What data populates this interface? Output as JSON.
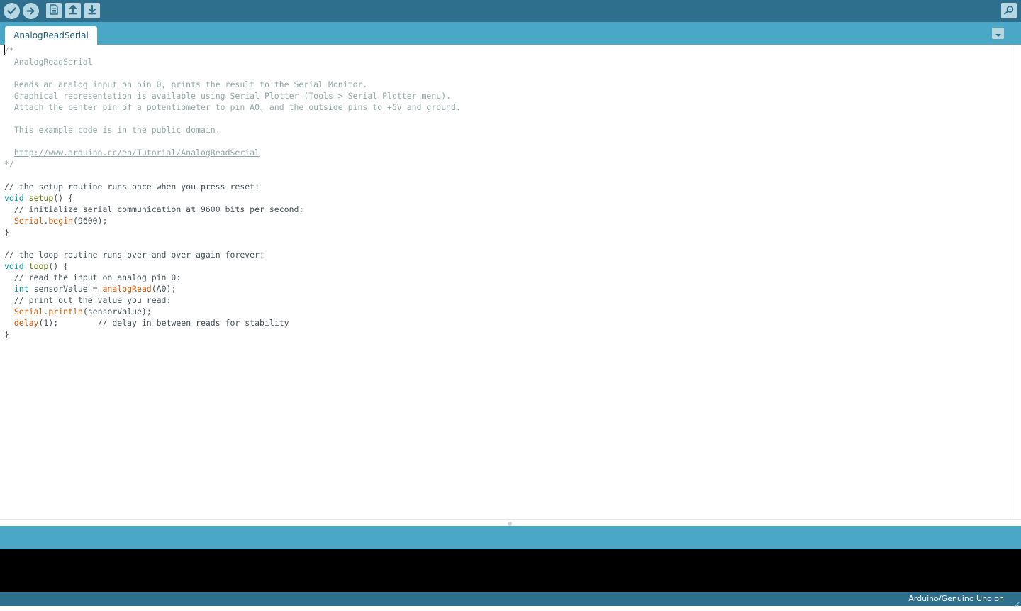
{
  "toolbar": {
    "buttons": [
      {
        "name": "verify",
        "icon": "checkmark-icon"
      },
      {
        "name": "upload",
        "icon": "arrow-right-icon"
      },
      {
        "name": "new",
        "icon": "new-file-icon"
      },
      {
        "name": "open",
        "icon": "open-up-arrow-icon"
      },
      {
        "name": "save",
        "icon": "save-down-arrow-icon"
      }
    ],
    "serial_monitor_icon": "magnifier-icon"
  },
  "tabs": [
    {
      "label": "AnalogReadSerial",
      "active": true
    }
  ],
  "tab_menu_icon": "chevron-down-icon",
  "editor": {
    "lines": [
      [
        {
          "t": "/*",
          "c": "c"
        }
      ],
      [
        {
          "t": "  AnalogReadSerial",
          "c": "c"
        }
      ],
      [],
      [
        {
          "t": "  Reads an analog input on pin 0, prints the result to the Serial Monitor.",
          "c": "c"
        }
      ],
      [
        {
          "t": "  Graphical representation is available using Serial Plotter (Tools > Serial Plotter menu).",
          "c": "c"
        }
      ],
      [
        {
          "t": "  Attach the center pin of a potentiometer to pin A0, and the outside pins to +5V and ground.",
          "c": "c"
        }
      ],
      [],
      [
        {
          "t": "  This example code is in the public domain.",
          "c": "c"
        }
      ],
      [],
      [
        {
          "t": "  ",
          "c": "c"
        },
        {
          "t": "http://www.arduino.cc/en/Tutorial/AnalogReadSerial",
          "c": "u"
        }
      ],
      [
        {
          "t": "*/",
          "c": "c"
        }
      ],
      [],
      [
        {
          "t": "// the setup routine runs once when you press reset:",
          "c": "p"
        }
      ],
      [
        {
          "t": "void",
          "c": "kw"
        },
        {
          "t": " ",
          "c": "p"
        },
        {
          "t": "setup",
          "c": "fn"
        },
        {
          "t": "() {",
          "c": "p"
        }
      ],
      [
        {
          "t": "  // initialize serial communication at 9600 bits per second:",
          "c": "p"
        }
      ],
      [
        {
          "t": "  ",
          "c": "p"
        },
        {
          "t": "Serial",
          "c": "lib"
        },
        {
          "t": ".",
          "c": "p"
        },
        {
          "t": "begin",
          "c": "lib"
        },
        {
          "t": "(9600);",
          "c": "p"
        }
      ],
      [
        {
          "t": "}",
          "c": "p"
        }
      ],
      [],
      [
        {
          "t": "// the loop routine runs over and over again forever:",
          "c": "p"
        }
      ],
      [
        {
          "t": "void",
          "c": "kw"
        },
        {
          "t": " ",
          "c": "p"
        },
        {
          "t": "loop",
          "c": "fn"
        },
        {
          "t": "() {",
          "c": "p"
        }
      ],
      [
        {
          "t": "  // read the input on analog pin 0:",
          "c": "p"
        }
      ],
      [
        {
          "t": "  ",
          "c": "p"
        },
        {
          "t": "int",
          "c": "kw"
        },
        {
          "t": " sensorValue = ",
          "c": "p"
        },
        {
          "t": "analogRead",
          "c": "lib"
        },
        {
          "t": "(A0);",
          "c": "p"
        }
      ],
      [
        {
          "t": "  // print out the value you read:",
          "c": "p"
        }
      ],
      [
        {
          "t": "  ",
          "c": "p"
        },
        {
          "t": "Serial",
          "c": "lib"
        },
        {
          "t": ".",
          "c": "p"
        },
        {
          "t": "println",
          "c": "lib"
        },
        {
          "t": "(sensorValue);",
          "c": "p"
        }
      ],
      [
        {
          "t": "  ",
          "c": "p"
        },
        {
          "t": "delay",
          "c": "lib"
        },
        {
          "t": "(1);        // delay in between reads for stability",
          "c": "p"
        }
      ],
      [
        {
          "t": "}",
          "c": "p"
        }
      ]
    ]
  },
  "status": {
    "board": "Arduino/Genuino Uno on"
  },
  "colors": {
    "toolbar": "#2d6f8d",
    "tabbar": "#4ba7c6",
    "comment": "#95a5a6",
    "keyword": "#00979c",
    "function": "#5e6d03",
    "library": "#d35400"
  }
}
